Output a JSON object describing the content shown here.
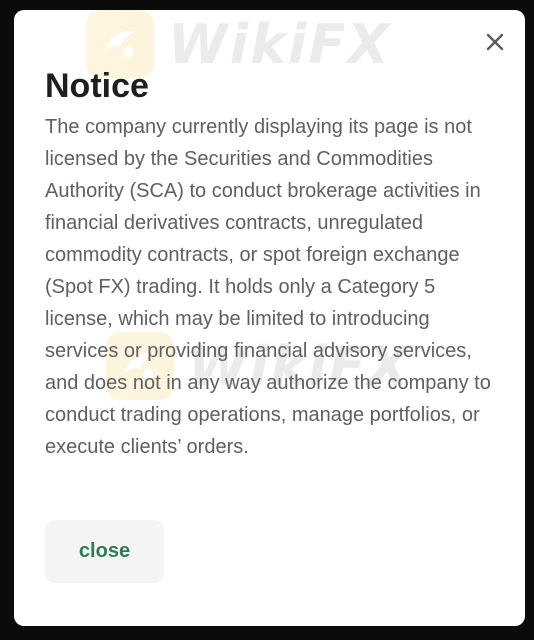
{
  "dialog": {
    "title": "Notice",
    "message": "The company currently displaying its page is not licensed by the Securities and Commodities Authority (SCA) to conduct brokerage activities in financial derivatives contracts, unregulated commodity contracts, or spot foreign exchange (Spot FX) trading. It holds only a Category 5 license, which may be limited to introducing services or providing financial advisory services, and does not in any way authorize the company to conduct trading operations, manage portfolios, or execute clients’ orders.",
    "close_label": "close",
    "dismiss_icon": "close-icon"
  },
  "watermark": {
    "text": "WikiFX",
    "logo_icon": "wikifx-logo-icon"
  },
  "colors": {
    "backdrop": "#0b0b0b",
    "dialog_bg": "#ffffff",
    "title": "#1f1f1f",
    "body_text": "#5f5f5f",
    "button_bg": "#f3f4f3",
    "button_text": "#2a7d55",
    "watermark_logo": "#f2c230"
  }
}
